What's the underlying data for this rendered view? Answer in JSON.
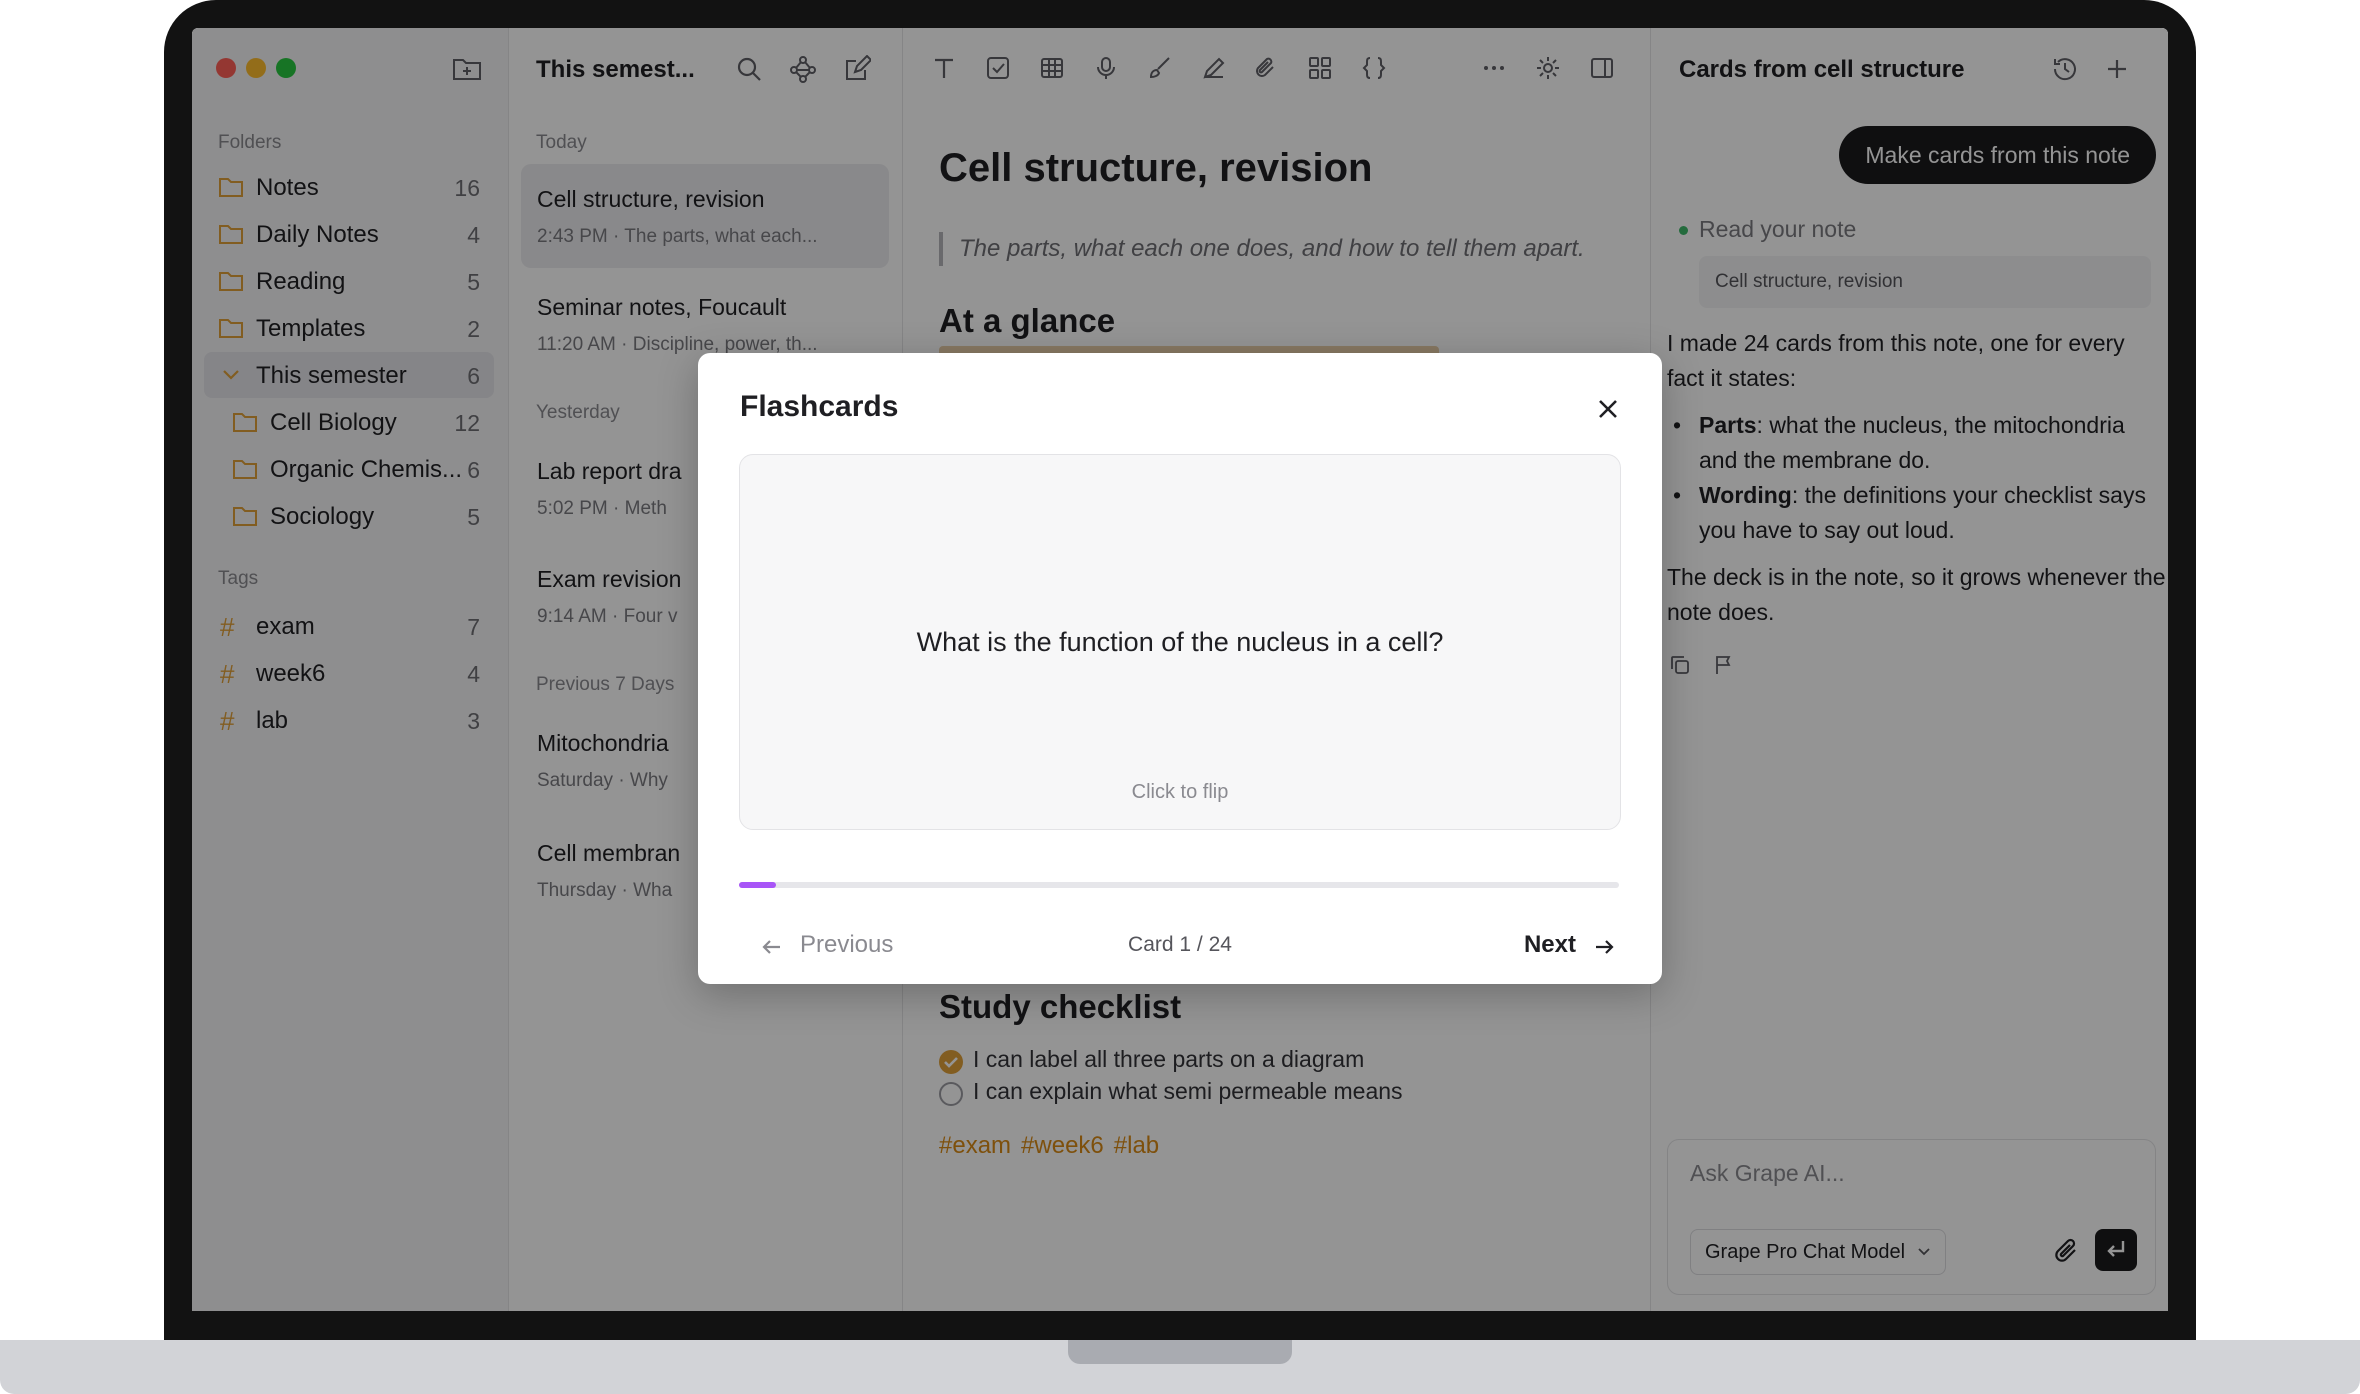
{
  "sidebar": {
    "folders_label": "Folders",
    "folders": [
      {
        "label": "Notes",
        "count": "16"
      },
      {
        "label": "Daily Notes",
        "count": "4"
      },
      {
        "label": "Reading",
        "count": "5"
      },
      {
        "label": "Templates",
        "count": "2"
      },
      {
        "label": "This semester",
        "count": "6"
      },
      {
        "label": "Cell Biology",
        "count": "12"
      },
      {
        "label": "Organic Chemis...",
        "count": "6"
      },
      {
        "label": "Sociology",
        "count": "5"
      }
    ],
    "tags_label": "Tags",
    "tags": [
      {
        "label": "exam",
        "count": "7"
      },
      {
        "label": "week6",
        "count": "4"
      },
      {
        "label": "lab",
        "count": "3"
      }
    ]
  },
  "list": {
    "title": "This semest...",
    "groups": [
      "Today",
      "Yesterday",
      "Previous 7 Days"
    ],
    "notes": [
      {
        "title": "Cell structure, revision",
        "sub": "2:43 PM · The parts, what each..."
      },
      {
        "title": "Seminar notes, Foucault",
        "sub": "11:20 AM · Discipline, power, th..."
      },
      {
        "title": "Lab report dra",
        "sub": "5:02 PM · Meth"
      },
      {
        "title": "Exam revision",
        "sub": "9:14 AM · Four v"
      },
      {
        "title": "Mitochondria",
        "sub": "Saturday · Why"
      },
      {
        "title": "Cell membran",
        "sub": "Thursday · Wha"
      }
    ]
  },
  "editor": {
    "title": "Cell structure, revision",
    "quote": "The parts, what each one does, and how to tell them apart.",
    "h_glance": "At a glance",
    "h_checklist": "Study checklist",
    "checklist": [
      {
        "text": "I can label all three parts on a diagram",
        "checked": true
      },
      {
        "text": "I can explain what semi permeable means",
        "checked": false
      }
    ],
    "tags": [
      "#exam",
      "#week6",
      "#lab"
    ]
  },
  "ai": {
    "title": "Cards from cell structure",
    "pill": "Make cards from this note",
    "read_label": "Read your note",
    "note_ref": "Cell structure, revision",
    "intro": "I made 24 cards from this note, one for every fact it states:",
    "bullets": [
      {
        "bold": "Parts",
        "text": ": what the nucleus, the mitochondria and the membrane do."
      },
      {
        "bold": "Wording",
        "text": ": the definitions your checklist says you have to say out loud."
      }
    ],
    "outro": "The deck is in the note, so it grows whenever the note does.",
    "input_placeholder": "Ask Grape AI...",
    "model": "Grape Pro Chat Model"
  },
  "modal": {
    "title": "Flashcards",
    "question": "What is the function of the nucleus in a cell?",
    "hint": "Click to flip",
    "prev": "Previous",
    "next": "Next",
    "counter": "Card 1 / 24",
    "progress": 0.042
  },
  "colors": {
    "folder": "#e0a03a",
    "tag": "#d98b16",
    "progress": "#a855f7",
    "traffic_red": "#ff5f57",
    "traffic_yellow": "#febc2e",
    "traffic_green": "#28c840"
  }
}
